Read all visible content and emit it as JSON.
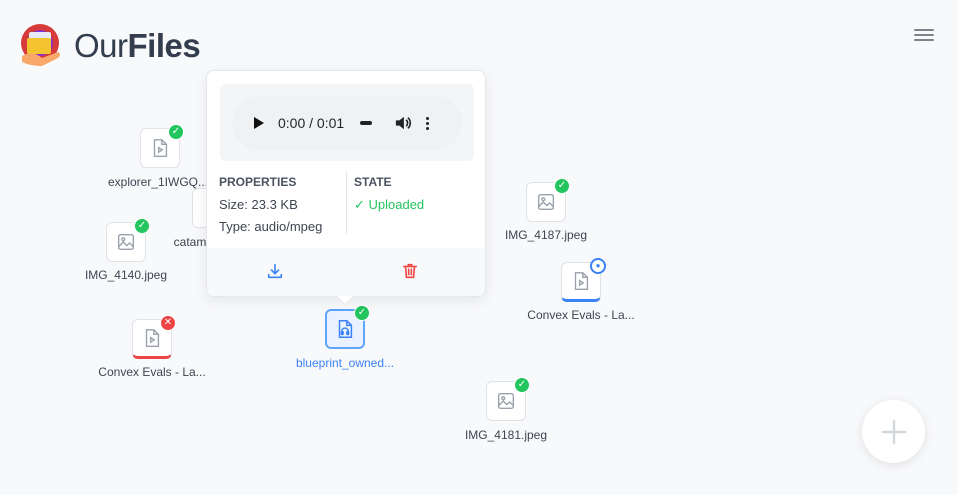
{
  "app": {
    "title_light": "Our",
    "title_bold": "Files"
  },
  "files": [
    {
      "name": "explorer_1IWGQ...",
      "icon": "video-file-icon",
      "status": "uploaded"
    },
    {
      "name": "catam",
      "icon": "file-icon",
      "status": "uploaded"
    },
    {
      "name": "IMG_4140.jpeg",
      "icon": "image-file-icon",
      "status": "uploaded"
    },
    {
      "name": "Convex Evals - La...",
      "icon": "video-file-icon",
      "status": "error"
    },
    {
      "name": "blueprint_owned...",
      "icon": "audio-file-icon",
      "status": "uploaded"
    },
    {
      "name": "IMG_4187.jpeg",
      "icon": "image-file-icon",
      "status": "uploaded"
    },
    {
      "name": "Convex Evals - La...",
      "icon": "video-file-icon",
      "status": "uploading"
    },
    {
      "name": "IMG_4181.jpeg",
      "icon": "image-file-icon",
      "status": "uploaded"
    }
  ],
  "popover": {
    "player": {
      "time": "0:00 / 0:01"
    },
    "properties_heading": "PROPERTIES",
    "size": "Size: 23.3 KB",
    "type": "Type: audio/mpeg",
    "state_heading": "STATE",
    "state_value": "✓ Uploaded"
  },
  "colors": {
    "accent": "#3b82f6",
    "success": "#22c55e",
    "danger": "#ef4444"
  }
}
